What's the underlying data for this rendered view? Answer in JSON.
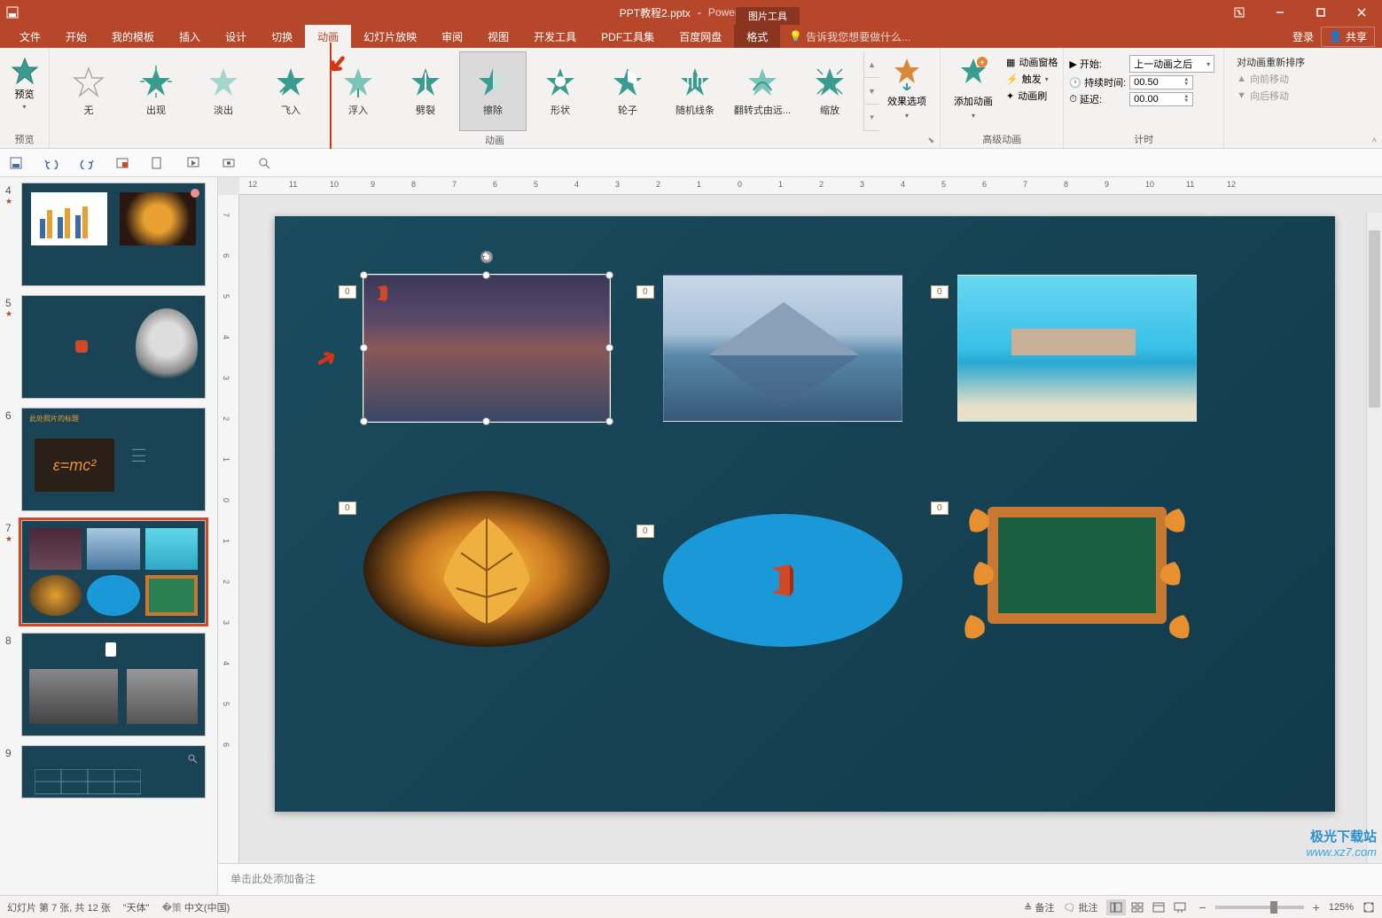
{
  "title": {
    "filename": "PPT教程2.pptx",
    "appname": "PowerPoint",
    "tool_tab": "图片工具"
  },
  "menu": {
    "tabs": [
      "文件",
      "开始",
      "我的模板",
      "插入",
      "设计",
      "切换",
      "动画",
      "幻灯片放映",
      "审阅",
      "视图",
      "开发工具",
      "PDF工具集",
      "百度网盘",
      "格式"
    ],
    "active": "动画",
    "tell_me": "告诉我您想要做什么...",
    "login": "登录",
    "share": "共享"
  },
  "ribbon": {
    "preview": {
      "label": "预览",
      "group": "预览"
    },
    "animations": [
      "无",
      "出现",
      "淡出",
      "飞入",
      "浮入",
      "劈裂",
      "擦除",
      "形状",
      "轮子",
      "随机线条",
      "翻转式由远...",
      "缩放"
    ],
    "selected_anim": "擦除",
    "anim_group": "动画",
    "effect_options": "效果选项",
    "add_anim": "添加动画",
    "adv": {
      "pane": "动画窗格",
      "trigger": "触发",
      "painter": "动画刷",
      "group": "高级动画"
    },
    "timing": {
      "start_lbl": "开始:",
      "start_val": "上一动画之后",
      "duration_lbl": "持续时间:",
      "duration_val": "00.50",
      "delay_lbl": "延迟:",
      "delay_val": "00.00",
      "group": "计时"
    },
    "reorder": {
      "title": "对动画重新排序",
      "fwd": "向前移动",
      "back": "向后移动"
    }
  },
  "slides": [
    {
      "num": "4"
    },
    {
      "num": "5"
    },
    {
      "num": "6"
    },
    {
      "num": "7"
    },
    {
      "num": "8"
    },
    {
      "num": "9"
    }
  ],
  "canvas": {
    "tags": [
      "0",
      "0",
      "0",
      "0",
      "0",
      "0"
    ]
  },
  "notes_placeholder": "单击此处添加备注",
  "status": {
    "slide_info": "幻灯片 第 7 张, 共 12 张",
    "theme": "\"天体\"",
    "lang": "中文(中国)",
    "notes_btn": "备注",
    "comments_btn": "批注",
    "zoom": "125%"
  },
  "watermark": {
    "name": "极光下载站",
    "url": "www.xz7.com"
  },
  "thumb6_title": "此处照片的标题"
}
